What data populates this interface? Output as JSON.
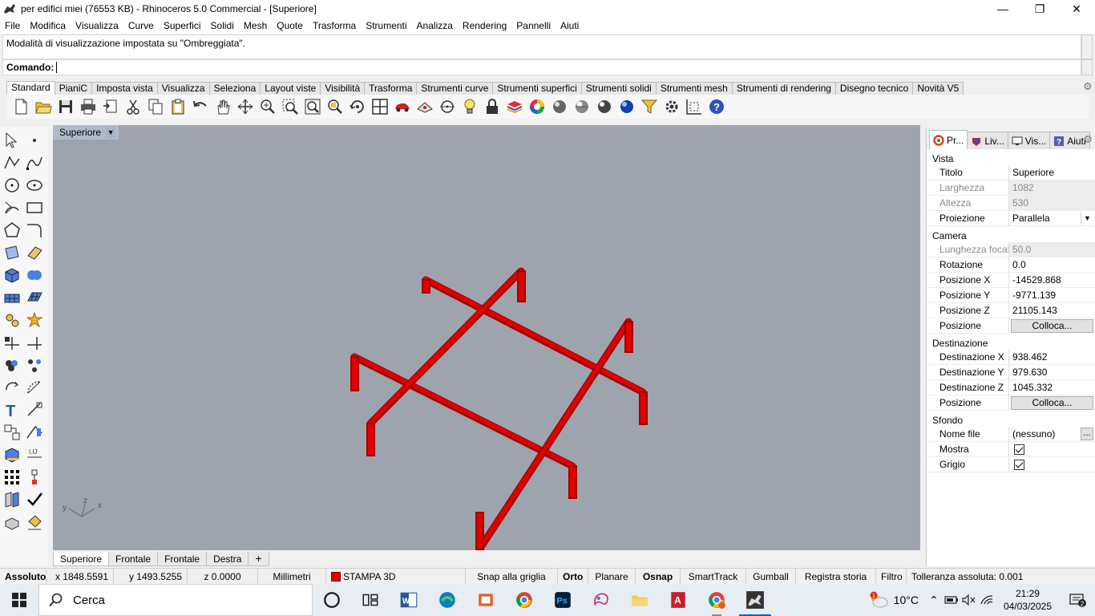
{
  "window": {
    "title": "per edifici miei (76553 KB) - Rhinoceros 5.0 Commercial - [Superiore]",
    "minimize": "—",
    "maximize": "❐",
    "close": "✕"
  },
  "menu": [
    "File",
    "Modifica",
    "Visualizza",
    "Curve",
    "Superfici",
    "Solidi",
    "Mesh",
    "Quote",
    "Trasforma",
    "Strumenti",
    "Analizza",
    "Rendering",
    "Pannelli",
    "Aiuti"
  ],
  "command": {
    "history": "Modalità di visualizzazione impostata su \"Ombreggiata\".",
    "prompt": "Comando:"
  },
  "toolbar_tabs": [
    "Standard",
    "PianiC",
    "Imposta vista",
    "Visualizza",
    "Seleziona",
    "Layout viste",
    "Visibilità",
    "Trasforma",
    "Strumenti curve",
    "Strumenti superfici",
    "Strumenti solidi",
    "Strumenti mesh",
    "Strumenti di rendering",
    "Disegno tecnico",
    "Novità V5"
  ],
  "toolbar_tabs_active": "Standard",
  "main_toolbar_icons": [
    "new-file-icon",
    "open-file-icon",
    "save-icon",
    "print-icon",
    "import-icon",
    "cut-icon",
    "copy-icon",
    "paste-icon",
    "undo-icon",
    "pan-hand-icon",
    "move-view-icon",
    "zoom-dynamic-icon",
    "zoom-window-icon",
    "zoom-extents-icon",
    "zoom-selected-icon",
    "rotate-view-icon",
    "four-viewports-icon",
    "car-icon",
    "camera-target-icon",
    "osnap-circle-icon",
    "light-bulb-icon",
    "lock-icon",
    "layer-icon",
    "color-wheel-icon",
    "render-sphere-icon",
    "shaded-sphere-icon",
    "rendered-sphere-icon",
    "blue-sphere-icon",
    "filter-icon",
    "options-gear-icon",
    "grid-snap-icon",
    "help-icon"
  ],
  "viewport": {
    "label": "Superiore",
    "background": "#9ea4ad",
    "object_color": "#e00000",
    "axes": {
      "x": "x",
      "y": "y",
      "z": "z"
    }
  },
  "viewport_tabs": [
    "Superiore",
    "Frontale",
    "Frontale",
    "Destra"
  ],
  "viewport_tabs_add": "+",
  "panel": {
    "tabs": [
      {
        "label": "Pr...",
        "icon": "properties-icon"
      },
      {
        "label": "Liv...",
        "icon": "layers-icon"
      },
      {
        "label": "Vis...",
        "icon": "display-icon"
      },
      {
        "label": "Aiuti",
        "icon": "help-icon"
      }
    ],
    "sections": {
      "vista": "Vista",
      "camera": "Camera",
      "destinazione": "Destinazione",
      "sfondo": "Sfondo"
    },
    "vista": {
      "titolo_label": "Titolo",
      "titolo": "Superiore",
      "larghezza_label": "Larghezza",
      "larghezza": "1082",
      "altezza_label": "Altezza",
      "altezza": "530",
      "proiezione_label": "Proiezione",
      "proiezione": "Parallela"
    },
    "camera": {
      "focale_label": "Lunghezza focale",
      "focale": "50.0",
      "rotazione_label": "Rotazione",
      "rotazione": "0.0",
      "posx_label": "Posizione X",
      "posx": "-14529.868",
      "posy_label": "Posizione Y",
      "posy": "-9771.139",
      "posz_label": "Posizione Z",
      "posz": "21105.143",
      "pos_label": "Posizione",
      "pos_button": "Colloca..."
    },
    "destinazione": {
      "x_label": "Destinazione X",
      "x": "938.462",
      "y_label": "Destinazione Y",
      "y": "979.630",
      "z_label": "Destinazione Z",
      "z": "1045.332",
      "pos_label": "Posizione",
      "pos_button": "Colloca..."
    },
    "sfondo": {
      "nome_label": "Nome file",
      "nome": "(nessuno)",
      "nome_button": "...",
      "mostra_label": "Mostra",
      "mostra": true,
      "grigio_label": "Grigio",
      "grigio": true
    }
  },
  "status": {
    "assoluto": "Assoluto",
    "x": "x 1848.5591",
    "y": "y 1493.5255",
    "z": "z 0.0000",
    "units": "Millimetri",
    "layer": "STAMPA 3D",
    "layer_color": "#e00000",
    "snap_grid": "Snap alla griglia",
    "orto": "Orto",
    "planare": "Planare",
    "osnap": "Osnap",
    "smarttrack": "SmartTrack",
    "gumball": "Gumball",
    "registra": "Registra storia",
    "filtro": "Filtro",
    "tolleranza": "Tolleranza assoluta: 0.001"
  },
  "taskbar": {
    "search": "Cerca",
    "apps": [
      "cortana-icon",
      "task-view-icon",
      "word-icon",
      "edge-icon",
      "office-icon",
      "chrome-icon",
      "photoshop-icon",
      "paint3d-icon",
      "file-explorer-icon",
      "autocad-icon",
      "chrome-profile-icon",
      "rhino-icon"
    ],
    "weather_temp": "10°C",
    "weather_badge": "1",
    "time": "21:29",
    "date": "04/03/2025",
    "notifications": "2"
  }
}
